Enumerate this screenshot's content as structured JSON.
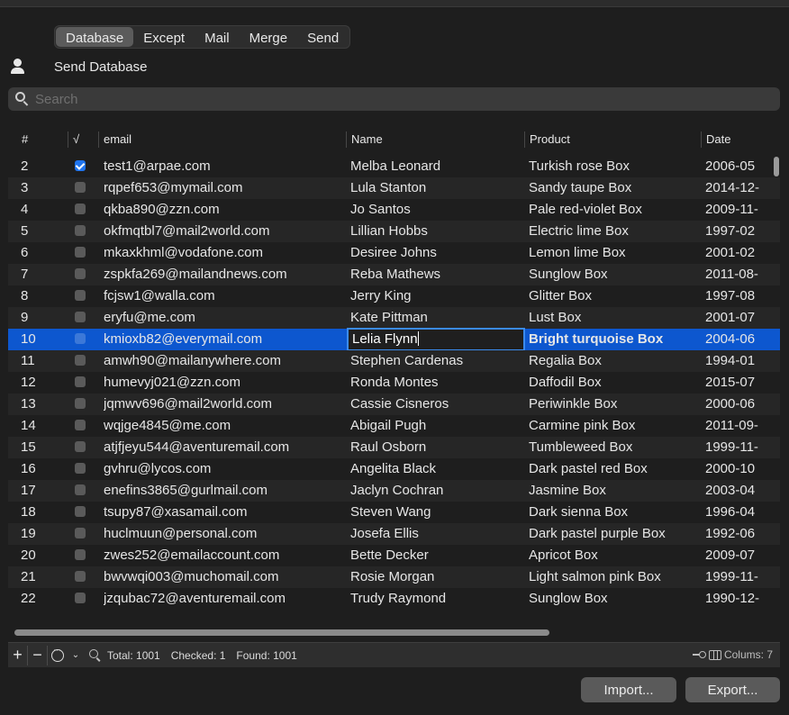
{
  "tabs": [
    {
      "label": "Database",
      "active": true
    },
    {
      "label": "Except",
      "active": false
    },
    {
      "label": "Mail",
      "active": false
    },
    {
      "label": "Merge",
      "active": false
    },
    {
      "label": "Send",
      "active": false
    }
  ],
  "header": {
    "title": "Send Database",
    "icon": "person-icon"
  },
  "search": {
    "placeholder": "Search",
    "value": ""
  },
  "table": {
    "columns": [
      "#",
      "√",
      "email",
      "Name",
      "Product",
      "Date"
    ],
    "rows": [
      {
        "num": "2",
        "checked": true,
        "email": "test1@arpae.com",
        "name": "Melba Leonard",
        "product": "Turkish rose Box",
        "date": "2006-05"
      },
      {
        "num": "3",
        "checked": false,
        "email": "rqpef653@mymail.com",
        "name": "Lula Stanton",
        "product": "Sandy taupe Box",
        "date": "2014-12-"
      },
      {
        "num": "4",
        "checked": false,
        "email": "qkba890@zzn.com",
        "name": "Jo Santos",
        "product": "Pale red-violet Box",
        "date": "2009-11-"
      },
      {
        "num": "5",
        "checked": false,
        "email": "okfmqtbl7@mail2world.com",
        "name": "Lillian Hobbs",
        "product": "Electric lime Box",
        "date": "1997-02"
      },
      {
        "num": "6",
        "checked": false,
        "email": "mkaxkhml@vodafone.com",
        "name": "Desiree Johns",
        "product": "Lemon lime Box",
        "date": "2001-02"
      },
      {
        "num": "7",
        "checked": false,
        "email": "zspkfa269@mailandnews.com",
        "name": "Reba Mathews",
        "product": "Sunglow Box",
        "date": "2011-08-"
      },
      {
        "num": "8",
        "checked": false,
        "email": "fcjsw1@walla.com",
        "name": "Jerry King",
        "product": "Glitter Box",
        "date": "1997-08"
      },
      {
        "num": "9",
        "checked": false,
        "email": "eryfu@me.com",
        "name": "Kate Pittman",
        "product": "Lust Box",
        "date": "2001-07"
      },
      {
        "num": "10",
        "checked": false,
        "email": "kmioxb82@everymail.com",
        "name": "Lelia Flynn",
        "product": "Bright turquoise Box",
        "date": "2004-06",
        "selected": true,
        "editing": true
      },
      {
        "num": "11",
        "checked": false,
        "email": "amwh90@mailanywhere.com",
        "name": "Stephen Cardenas",
        "product": "Regalia Box",
        "date": "1994-01"
      },
      {
        "num": "12",
        "checked": false,
        "email": "humevyj021@zzn.com",
        "name": "Ronda Montes",
        "product": "Daffodil Box",
        "date": "2015-07"
      },
      {
        "num": "13",
        "checked": false,
        "email": "jqmwv696@mail2world.com",
        "name": "Cassie Cisneros",
        "product": "Periwinkle Box",
        "date": "2000-06"
      },
      {
        "num": "14",
        "checked": false,
        "email": "wqjge4845@me.com",
        "name": "Abigail Pugh",
        "product": "Carmine pink Box",
        "date": "2011-09-"
      },
      {
        "num": "15",
        "checked": false,
        "email": "atjfjeyu544@aventuremail.com",
        "name": "Raul Osborn",
        "product": "Tumbleweed Box",
        "date": "1999-11-"
      },
      {
        "num": "16",
        "checked": false,
        "email": "gvhru@lycos.com",
        "name": "Angelita Black",
        "product": "Dark pastel red Box",
        "date": "2000-10"
      },
      {
        "num": "17",
        "checked": false,
        "email": "enefins3865@gurlmail.com",
        "name": "Jaclyn Cochran",
        "product": "Jasmine Box",
        "date": "2003-04"
      },
      {
        "num": "18",
        "checked": false,
        "email": "tsupy87@xasamail.com",
        "name": "Steven Wang",
        "product": "Dark sienna Box",
        "date": "1996-04"
      },
      {
        "num": "19",
        "checked": false,
        "email": "huclmuun@personal.com",
        "name": "Josefa Ellis",
        "product": "Dark pastel purple Box",
        "date": "1992-06"
      },
      {
        "num": "20",
        "checked": false,
        "email": "zwes252@emailaccount.com",
        "name": "Bette Decker",
        "product": "Apricot Box",
        "date": "2009-07"
      },
      {
        "num": "21",
        "checked": false,
        "email": "bwvwqi003@muchomail.com",
        "name": "Rosie Morgan",
        "product": "Light salmon pink Box",
        "date": "1999-11-"
      },
      {
        "num": "22",
        "checked": false,
        "email": "jzqubac72@aventuremail.com",
        "name": "Trudy Raymond",
        "product": "Sunglow Box",
        "date": "1990-12-"
      }
    ]
  },
  "toolbar": {
    "add": "+",
    "remove": "−",
    "chevron": "⌄",
    "total": "Total: 1001",
    "checked": "Checked: 1",
    "found": "Found: 1001",
    "columns": "Colums: 7"
  },
  "buttons": {
    "import": "Import...",
    "export": "Export..."
  },
  "colors": {
    "accent": "#0d57cf",
    "background": "#1e1e1e",
    "button": "#5a5a5a"
  }
}
